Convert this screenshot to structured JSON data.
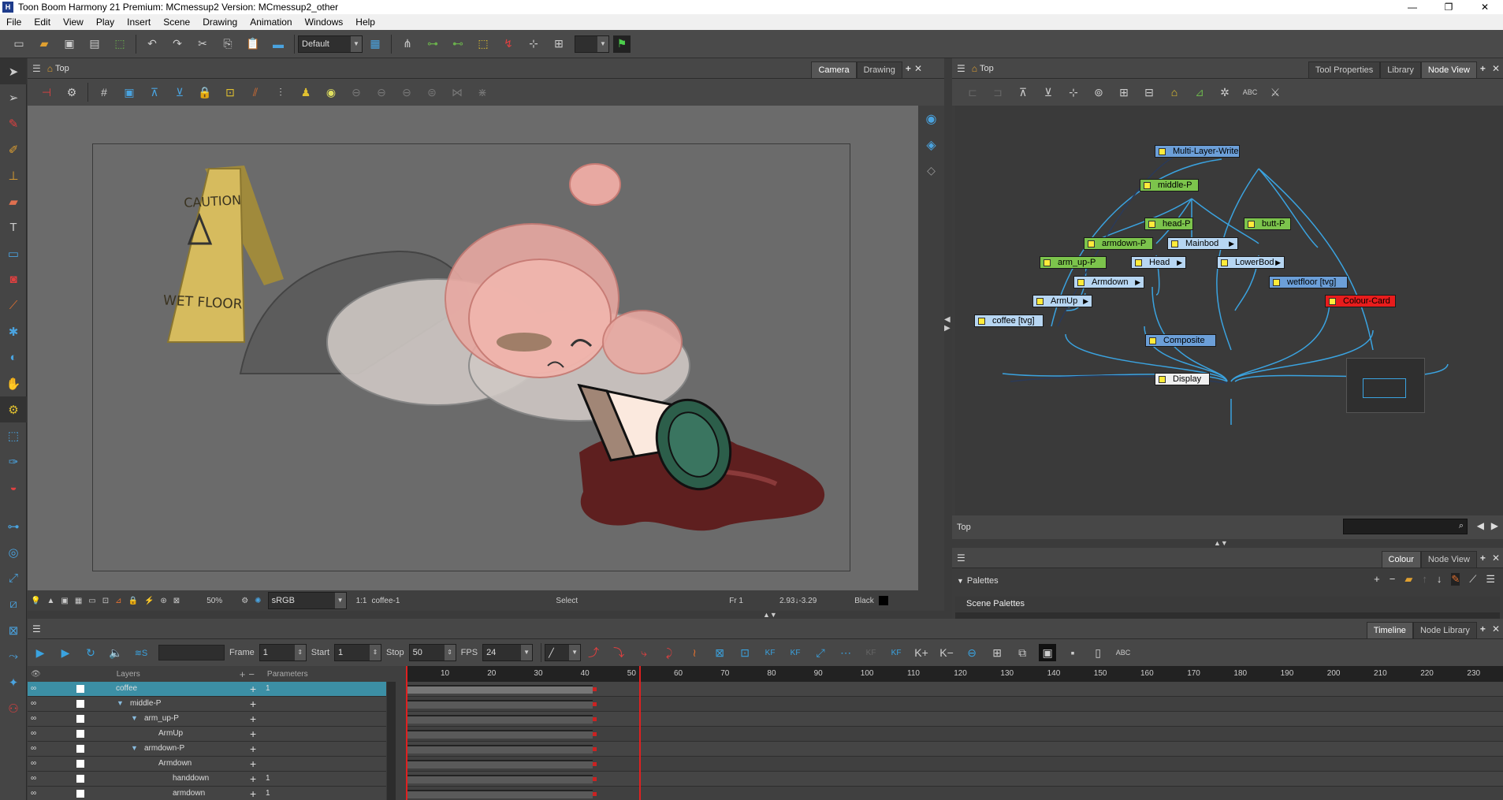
{
  "title": "Toon Boom Harmony 21 Premium: MCmessup2 Version: MCmessup2_other",
  "menu": [
    "File",
    "Edit",
    "View",
    "Play",
    "Insert",
    "Scene",
    "Drawing",
    "Animation",
    "Windows",
    "Help"
  ],
  "toolbar": {
    "workspace": "Default"
  },
  "camera_panel": {
    "breadcrumb": "Top",
    "tabs": [
      "Camera",
      "Drawing"
    ],
    "active_tab": "Camera",
    "status": {
      "zoom": "50%",
      "colorspace": "sRGB",
      "ratio": "1:1",
      "drawing": "coffee-1",
      "tool": "Select",
      "frame": "Fr 1",
      "coords": "2.93↓-3.29",
      "color": "Black"
    }
  },
  "artwork": {
    "sign_line1": "CAUTION",
    "sign_line2": "WET FLOOR"
  },
  "node_panel": {
    "breadcrumb": "Top",
    "tabs": [
      "Tool Properties",
      "Library",
      "Node View"
    ],
    "active_tab": "Node View",
    "footer_label": "Top",
    "nodes": [
      {
        "name": "Multi-Layer-Write",
        "color": "blue"
      },
      {
        "name": "middle-P",
        "color": "green"
      },
      {
        "name": "head-P",
        "color": "green"
      },
      {
        "name": "butt-P",
        "color": "green"
      },
      {
        "name": "armdown-P",
        "color": "green"
      },
      {
        "name": "Mainbod",
        "color": "lightblue"
      },
      {
        "name": "arm_up-P",
        "color": "green"
      },
      {
        "name": "Head",
        "color": "lightblue"
      },
      {
        "name": "LowerBod",
        "color": "lightblue"
      },
      {
        "name": "Armdown",
        "color": "lightblue"
      },
      {
        "name": "wetfloor [tvg]",
        "color": "blue"
      },
      {
        "name": "Colour-Card",
        "color": "red"
      },
      {
        "name": "ArmUp",
        "color": "lightblue"
      },
      {
        "name": "coffee [tvg]",
        "color": "lightblue"
      },
      {
        "name": "Composite",
        "color": "blue"
      },
      {
        "name": "Display",
        "color": "white"
      }
    ]
  },
  "colour_panel": {
    "tabs": [
      "Colour",
      "Node View"
    ],
    "active_tab": "Colour",
    "palettes_label": "Palettes",
    "scene_palettes": "Scene Palettes"
  },
  "timeline_panel": {
    "tabs": [
      "Timeline",
      "Node Library"
    ],
    "active_tab": "Timeline",
    "frame_label": "Frame",
    "frame": "1",
    "start_label": "Start",
    "start": "1",
    "stop_label": "Stop",
    "stop": "50",
    "fps_label": "FPS",
    "fps": "24",
    "layers_header": "Layers",
    "params_header": "Parameters",
    "ruler": [
      "10",
      "20",
      "30",
      "40",
      "50",
      "60",
      "70",
      "80",
      "90",
      "100",
      "110",
      "120",
      "130",
      "140",
      "150",
      "160",
      "170",
      "180",
      "190",
      "200",
      "210",
      "220",
      "230"
    ],
    "layers": [
      {
        "name": "coffee",
        "indent": 0,
        "selected": true,
        "value": "1"
      },
      {
        "name": "middle-P",
        "indent": 1,
        "selected": false,
        "value": ""
      },
      {
        "name": "arm_up-P",
        "indent": 2,
        "selected": false,
        "value": ""
      },
      {
        "name": "ArmUp",
        "indent": 3,
        "selected": false,
        "value": ""
      },
      {
        "name": "armdown-P",
        "indent": 2,
        "selected": false,
        "value": ""
      },
      {
        "name": "Armdown",
        "indent": 3,
        "selected": false,
        "value": ""
      },
      {
        "name": "handdown",
        "indent": 4,
        "selected": false,
        "value": "1"
      },
      {
        "name": "armdown",
        "indent": 4,
        "selected": false,
        "value": "1"
      }
    ]
  }
}
